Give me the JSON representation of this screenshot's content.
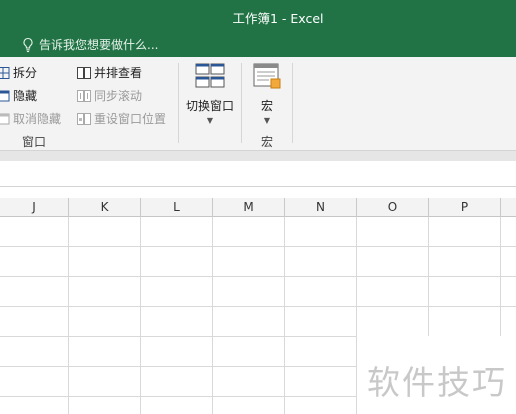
{
  "window": {
    "title": "工作簿1 - Excel"
  },
  "tell_me": {
    "placeholder": "告诉我您想要做什么..."
  },
  "ribbon": {
    "window_group": {
      "label": "窗口",
      "split_label": "拆分",
      "hide_label": "隐藏",
      "unhide_label": "取消隐藏",
      "side_by_side_label": "并排查看",
      "sync_scroll_label": "同步滚动",
      "reset_position_label": "重设窗口位置",
      "switch_windows_label": "切换窗口"
    },
    "macros_group": {
      "label": "宏",
      "macros_label": "宏"
    }
  },
  "grid": {
    "columns": [
      "J",
      "K",
      "L",
      "M",
      "N",
      "O",
      "P"
    ]
  },
  "watermark": {
    "text": "软件技巧"
  },
  "colors": {
    "title_bar": "#217346",
    "ribbon": "#f3f3f3"
  }
}
